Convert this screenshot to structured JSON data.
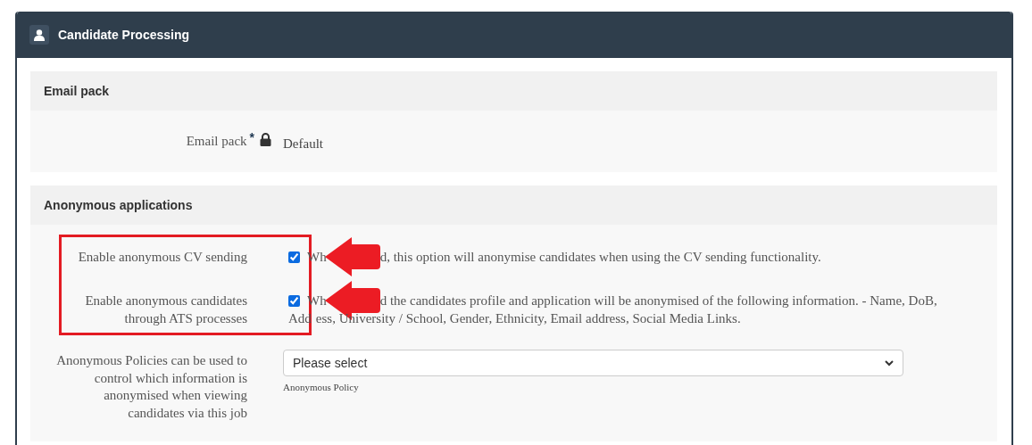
{
  "panel": {
    "title": "Candidate Processing"
  },
  "sections": [
    {
      "title": "Email pack",
      "fields": [
        {
          "kind": "locked",
          "label": "Email pack",
          "required_mark": "*",
          "value": "Default",
          "highlighted": false,
          "arrow": false
        }
      ]
    },
    {
      "title": "Anonymous applications",
      "fields": [
        {
          "kind": "checkbox",
          "label": "Enable anonymous CV sending",
          "checked": true,
          "highlighted": true,
          "arrow": true,
          "description_lines": [
            [
              "Wh",
              "d, this option will anonymise candidates when using the CV sending functionality."
            ]
          ]
        },
        {
          "kind": "checkbox",
          "label": "Enable anonymous candidates through ATS processes",
          "checked": true,
          "highlighted": true,
          "arrow": true,
          "description_lines": [
            [
              "Wh",
              "d the candidates profile and application will be anonymised of the following information. - Name, DoB,"
            ],
            [
              "Add",
              "ess, University / School, Gender, Ethnicity, Email address, Social Media Links."
            ]
          ]
        },
        {
          "kind": "select",
          "label": "Anonymous Policies can be used to control which information is anonymised when viewing candidates via this job",
          "placeholder": "Please select",
          "help": "Anonymous Policy",
          "highlighted": false,
          "arrow": false
        }
      ]
    }
  ]
}
